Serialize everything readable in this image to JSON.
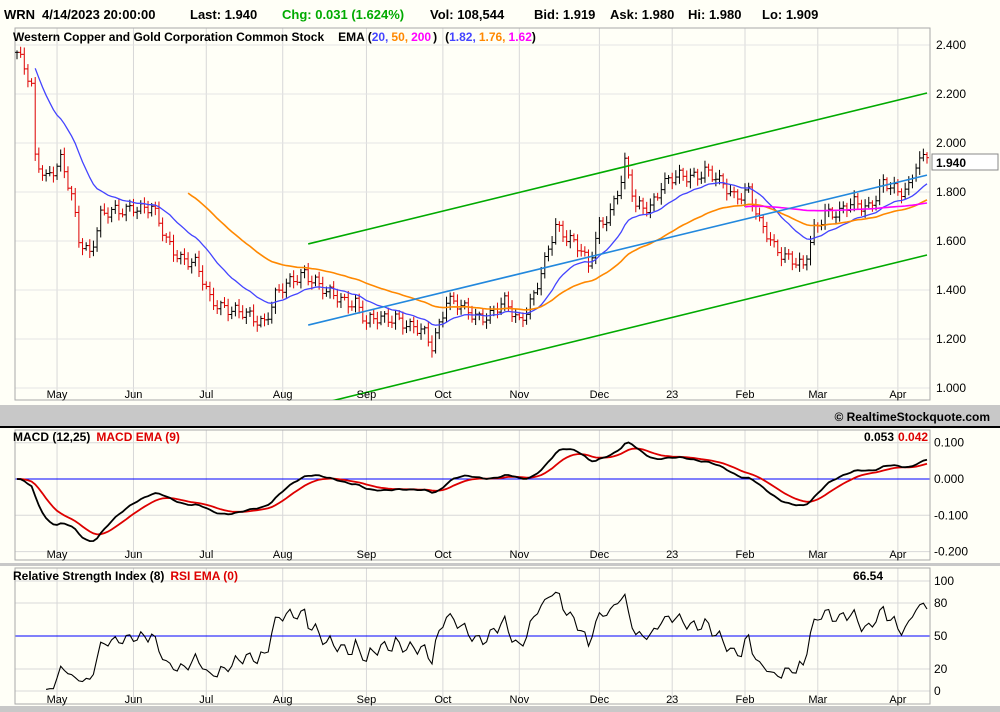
{
  "header": {
    "symbol": "WRN",
    "datetime": "4/14/2023 20:00:00",
    "last": "Last: 1.940",
    "chg": "Chg: 0.031 (1.624%)",
    "vol": "Vol: 108,544",
    "bid": "Bid: 1.919",
    "ask": "Ask: 1.980",
    "hi": "Hi: 1.980",
    "lo": "Lo: 1.909"
  },
  "colors": {
    "up": "#000000",
    "down": "#dd0000",
    "ema20": "#4444ff",
    "ema50": "#ff8800",
    "ema200": "#ff00ff",
    "channel": "#00aa00",
    "midline": "#2288dd",
    "chg": "#00aa00",
    "macd": "#000000",
    "signal": "#dd0000",
    "zero": "#0000ff"
  },
  "copyright": "© RealtimeStockquote.com",
  "chart_data": [
    {
      "type": "ohlc",
      "title": "Western Copper and Gold Corporation Common Stock",
      "ema_label": "EMA (",
      "ema_periods": [
        "20,",
        "50,",
        "200"
      ],
      "ema_values": [
        "1.82,",
        "1.76,",
        "1.62"
      ],
      "last_label": "1.940",
      "x_months": [
        {
          "label": "May",
          "t": 11
        },
        {
          "label": "Jun",
          "t": 32
        },
        {
          "label": "Jul",
          "t": 52
        },
        {
          "label": "Aug",
          "t": 73
        },
        {
          "label": "Sep",
          "t": 96
        },
        {
          "label": "Oct",
          "t": 117
        },
        {
          "label": "Nov",
          "t": 138
        },
        {
          "label": "Dec",
          "t": 160
        },
        {
          "label": "23",
          "t": 180
        },
        {
          "label": "Feb",
          "t": 200
        },
        {
          "label": "Mar",
          "t": 220
        },
        {
          "label": "Apr",
          "t": 242
        }
      ],
      "y_ticks": [
        "2.400",
        "2.200",
        "2.000",
        "1.800",
        "1.600",
        "1.400",
        "1.200",
        "1.000"
      ],
      "ylim": [
        1.0,
        2.4
      ],
      "days": 250,
      "close_keypoints": [
        [
          0,
          2.37
        ],
        [
          4,
          2.22
        ],
        [
          5,
          1.93
        ],
        [
          8,
          1.87
        ],
        [
          12,
          1.93
        ],
        [
          15,
          1.77
        ],
        [
          17,
          1.6
        ],
        [
          20,
          1.56
        ],
        [
          23,
          1.71
        ],
        [
          26,
          1.71
        ],
        [
          28,
          1.71
        ],
        [
          32,
          1.75
        ],
        [
          37,
          1.73
        ],
        [
          41,
          1.6
        ],
        [
          45,
          1.54
        ],
        [
          49,
          1.5
        ],
        [
          53,
          1.36
        ],
        [
          57,
          1.34
        ],
        [
          61,
          1.3
        ],
        [
          65,
          1.28
        ],
        [
          68,
          1.28
        ],
        [
          71,
          1.38
        ],
        [
          75,
          1.42
        ],
        [
          79,
          1.48
        ],
        [
          82,
          1.44
        ],
        [
          85,
          1.38
        ],
        [
          89,
          1.36
        ],
        [
          93,
          1.36
        ],
        [
          96,
          1.26
        ],
        [
          100,
          1.28
        ],
        [
          104,
          1.3
        ],
        [
          108,
          1.24
        ],
        [
          112,
          1.22
        ],
        [
          114,
          1.18
        ],
        [
          118,
          1.36
        ],
        [
          122,
          1.32
        ],
        [
          126,
          1.3
        ],
        [
          130,
          1.3
        ],
        [
          134,
          1.34
        ],
        [
          138,
          1.28
        ],
        [
          142,
          1.38
        ],
        [
          145,
          1.5
        ],
        [
          148,
          1.66
        ],
        [
          152,
          1.62
        ],
        [
          155,
          1.56
        ],
        [
          157,
          1.48
        ],
        [
          160,
          1.66
        ],
        [
          163,
          1.73
        ],
        [
          166,
          1.85
        ],
        [
          167,
          1.91
        ],
        [
          170,
          1.73
        ],
        [
          174,
          1.75
        ],
        [
          177,
          1.83
        ],
        [
          181,
          1.85
        ],
        [
          185,
          1.87
        ],
        [
          189,
          1.89
        ],
        [
          193,
          1.83
        ],
        [
          197,
          1.79
        ],
        [
          201,
          1.81
        ],
        [
          204,
          1.66
        ],
        [
          208,
          1.58
        ],
        [
          212,
          1.54
        ],
        [
          216,
          1.48
        ],
        [
          219,
          1.64
        ],
        [
          222,
          1.73
        ],
        [
          226,
          1.71
        ],
        [
          230,
          1.75
        ],
        [
          234,
          1.75
        ],
        [
          238,
          1.83
        ],
        [
          242,
          1.79
        ],
        [
          245,
          1.83
        ],
        [
          247,
          1.93
        ],
        [
          250,
          1.94
        ]
      ],
      "trendlines": [
        {
          "name": "upper-channel",
          "from": [
            80,
            1.588
          ],
          "to": [
            250,
            2.204
          ]
        },
        {
          "name": "lower-channel",
          "from": [
            82,
            0.931
          ],
          "to": [
            250,
            1.543
          ]
        },
        {
          "name": "mid-line",
          "from": [
            80,
            1.257
          ],
          "to": [
            250,
            1.869
          ]
        }
      ]
    },
    {
      "type": "line",
      "title": "MACD (12,25)",
      "signal_label": "MACD EMA (9)",
      "values": [
        "0.053",
        "0.042"
      ],
      "y_ticks": [
        "0.100",
        "0.000",
        "-0.100",
        "-0.200"
      ],
      "ylim": [
        -0.2,
        0.1
      ]
    },
    {
      "type": "line",
      "title": "Relative Strength Index (8)",
      "signal_label": "RSI EMA (0)",
      "value": "66.54",
      "y_ticks": [
        "100",
        "80",
        "50",
        "20",
        "0"
      ],
      "ylim": [
        0,
        100
      ]
    }
  ]
}
